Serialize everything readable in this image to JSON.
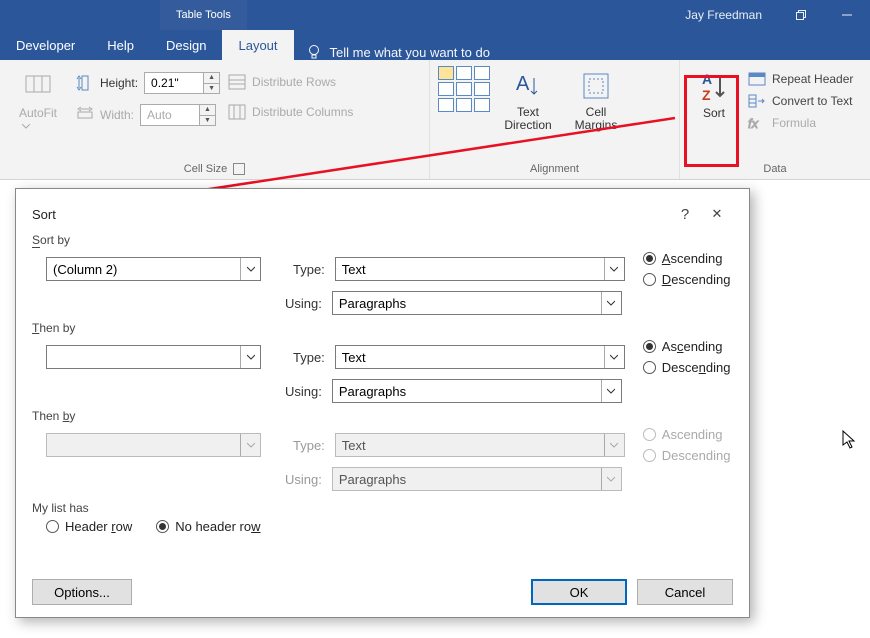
{
  "window": {
    "context_tab_label": "Table Tools",
    "user": "Jay Freedman"
  },
  "tabs": {
    "developer": "Developer",
    "help": "Help",
    "design": "Design",
    "layout": "Layout",
    "tell_me": "Tell me what you want to do"
  },
  "ribbon": {
    "autofit": "AutoFit",
    "height_label": "Height:",
    "height_value": "0.21\"",
    "width_label": "Width:",
    "width_value": "Auto",
    "distribute_rows": "Distribute Rows",
    "distribute_columns": "Distribute Columns",
    "cell_size_caption": "Cell Size",
    "text_direction": "Text\nDirection",
    "cell_margins": "Cell\nMargins",
    "alignment_caption": "Alignment",
    "sort": "Sort",
    "repeat_header": "Repeat Header",
    "convert_to_text": "Convert to Text",
    "formula": "Formula",
    "data_caption": "Data"
  },
  "dialog": {
    "title": "Sort",
    "help_symbol": "?",
    "close_symbol": "✕",
    "sort_by_label": "Sort by",
    "then_by_label": "Then by",
    "type_label": "Type:",
    "using_label": "Using:",
    "asc": "Ascending",
    "desc": "Descending",
    "list_has_label": "My list has",
    "header_row": "Header row",
    "no_header_row": "No header row",
    "options_btn": "Options...",
    "ok_btn": "OK",
    "cancel_btn": "Cancel",
    "levels": [
      {
        "field": "(Column 2)",
        "type": "Text",
        "using": "Paragraphs",
        "dir": "asc",
        "enabled": true
      },
      {
        "field": "",
        "type": "Text",
        "using": "Paragraphs",
        "dir": "asc",
        "enabled": true
      },
      {
        "field": "",
        "type": "Text",
        "using": "Paragraphs",
        "dir": "asc",
        "enabled": false
      }
    ]
  }
}
